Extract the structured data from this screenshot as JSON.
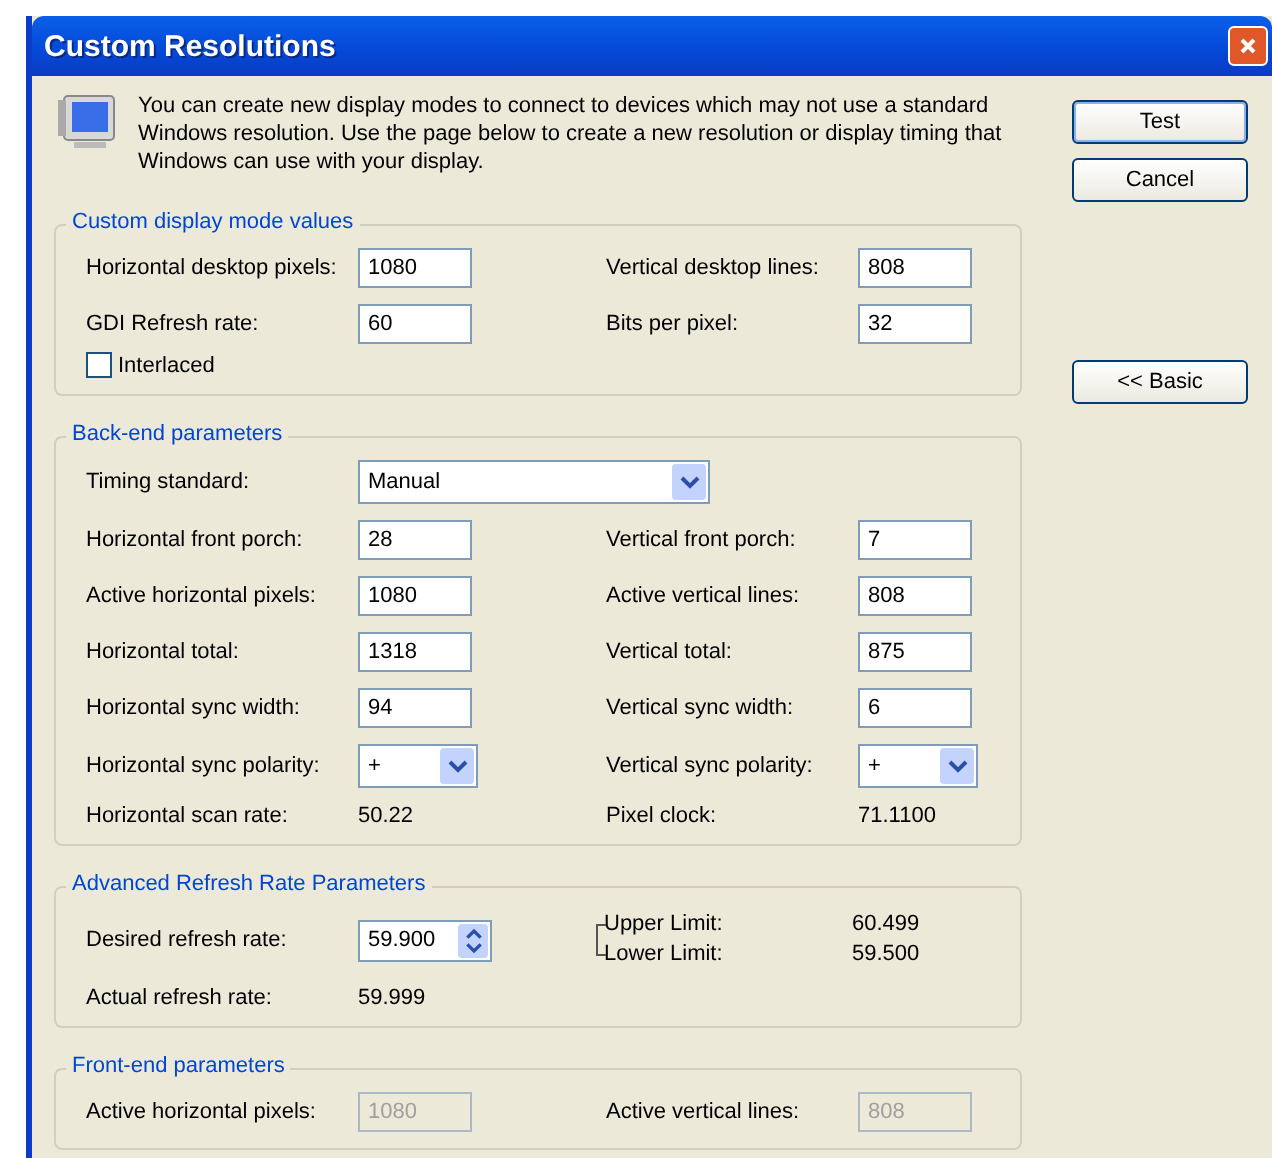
{
  "window": {
    "title": "Custom Resolutions"
  },
  "intro": "You can create new display modes to connect to devices which may not use a standard Windows resolution. Use the page below to create a new resolution or display timing that Windows can use with your display.",
  "buttons": [
    {
      "label": "Test",
      "default": true
    },
    {
      "label": "Cancel",
      "default": false
    },
    {
      "label": "<< Basic",
      "default": false
    }
  ],
  "groups": [
    {
      "title": "Custom display mode values",
      "kind": "grid",
      "fields": [
        {
          "label": "Horizontal desktop pixels:",
          "kind": "text",
          "value": "1080",
          "disabled": false
        },
        {
          "label": "Vertical desktop lines:",
          "kind": "text",
          "value": "808",
          "disabled": false
        },
        {
          "label": "GDI Refresh rate:",
          "kind": "text",
          "value": "60",
          "disabled": false
        },
        {
          "label": "Bits per pixel:",
          "kind": "text",
          "value": "32",
          "disabled": false
        },
        {
          "label": "Interlaced",
          "kind": "checkbox",
          "checked": false
        }
      ]
    },
    {
      "title": "Back-end parameters",
      "kind": "grid",
      "fields": [
        {
          "label": "Timing standard:",
          "kind": "combo",
          "value": "Manual"
        },
        {
          "label": "Horizontal front porch:",
          "kind": "text",
          "value": "28",
          "disabled": false
        },
        {
          "label": "Vertical front porch:",
          "kind": "text",
          "value": "7",
          "disabled": false
        },
        {
          "label": "Active horizontal pixels:",
          "kind": "text",
          "value": "1080",
          "disabled": false
        },
        {
          "label": "Active vertical lines:",
          "kind": "text",
          "value": "808",
          "disabled": false
        },
        {
          "label": "Horizontal total:",
          "kind": "text",
          "value": "1318",
          "disabled": false
        },
        {
          "label": "Vertical total:",
          "kind": "text",
          "value": "875",
          "disabled": false
        },
        {
          "label": "Horizontal sync width:",
          "kind": "text",
          "value": "94",
          "disabled": false
        },
        {
          "label": "Vertical sync width:",
          "kind": "text",
          "value": "6",
          "disabled": false
        },
        {
          "label": "Horizontal sync polarity:",
          "kind": "dropdown",
          "value": "+"
        },
        {
          "label": "Vertical sync polarity:",
          "kind": "dropdown",
          "value": "+"
        },
        {
          "label": "Horizontal scan rate:",
          "kind": "readout",
          "value": "50.22"
        },
        {
          "label": "Pixel clock:",
          "kind": "readout",
          "value": "71.1100"
        }
      ]
    },
    {
      "title": "Advanced Refresh Rate Parameters",
      "kind": "refresh",
      "desired": {
        "label": "Desired refresh rate:",
        "value": "59.900"
      },
      "limits": [
        {
          "label": "Upper Limit:",
          "value": "60.499"
        },
        {
          "label": "Lower Limit:",
          "value": "59.500"
        }
      ],
      "actual": {
        "label": "Actual refresh rate:",
        "value": "59.999"
      }
    },
    {
      "title": "Front-end parameters",
      "kind": "grid",
      "fields": [
        {
          "label": "Active horizontal pixels:",
          "kind": "text",
          "value": "1080",
          "disabled": true
        },
        {
          "label": "Active vertical lines:",
          "kind": "text",
          "value": "808",
          "disabled": true
        }
      ]
    }
  ]
}
